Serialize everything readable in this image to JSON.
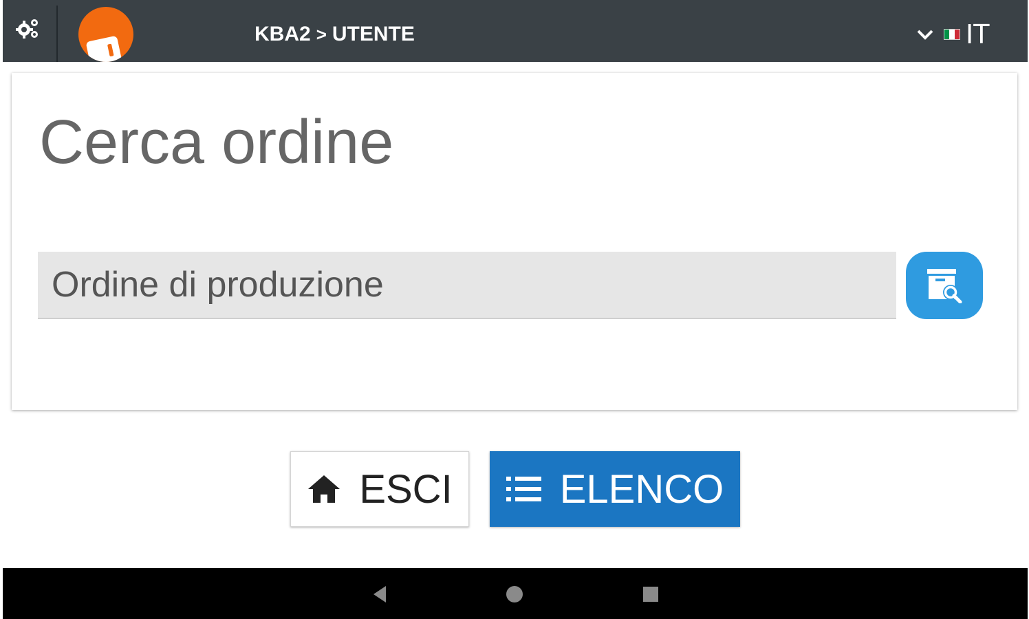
{
  "header": {
    "breadcrumb_parent": "KBA2",
    "breadcrumb_separator": ">",
    "breadcrumb_current": "UTENTE",
    "language": "IT",
    "flag_colors": [
      "#009246",
      "#ffffff",
      "#ce2b37"
    ],
    "icons": [
      "gears-icon",
      "app-logo",
      "chevron-down-icon",
      "italy-flag-icon"
    ]
  },
  "search_panel": {
    "title": "Cerca ordine",
    "input_placeholder": "Ordine di produzione",
    "input_value": "",
    "search_button_icon": "search-archive-icon",
    "search_button_color": "#2f9be0"
  },
  "actions": {
    "exit_label": "ESCI",
    "exit_icon": "home-icon",
    "list_label": "ELENCO",
    "list_icon": "list-icon",
    "list_button_color": "#1b76c2"
  },
  "system_nav": {
    "icons": [
      "back-icon",
      "home-circle-icon",
      "recents-icon"
    ]
  },
  "colors": {
    "topbar": "#3a4146",
    "logo": "#f26a10"
  }
}
